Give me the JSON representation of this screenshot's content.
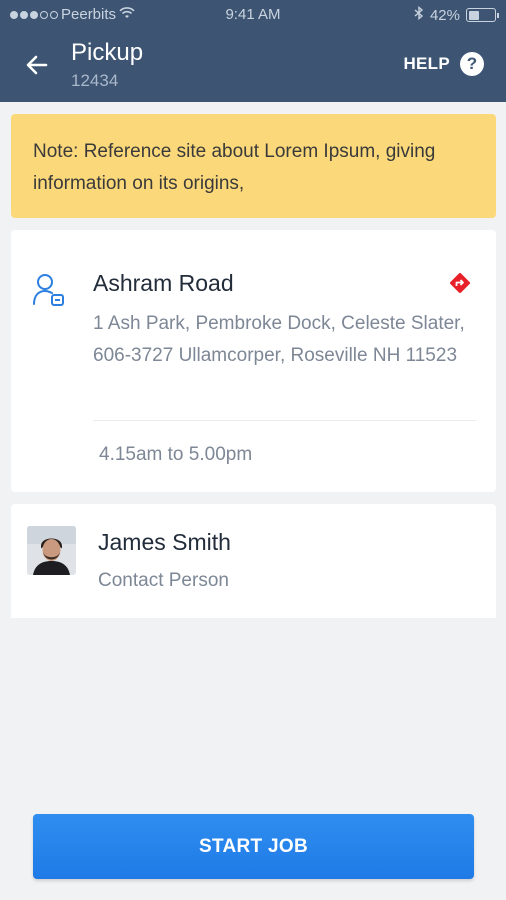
{
  "status_bar": {
    "carrier": "Peerbits",
    "time": "9:41 AM",
    "battery": "42%",
    "battery_level": 0.42,
    "signal_bars_filled": 3,
    "signal_bars_total": 5
  },
  "header": {
    "title": "Pickup",
    "subtitle": "12434",
    "help_label": "HELP",
    "help_icon_glyph": "?",
    "background_color": "#3d5573"
  },
  "note": {
    "text": "Note: Reference site about Lorem Ipsum, giving information on its origins,",
    "background_color": "#fbd97a"
  },
  "address_card": {
    "title": "Ashram Road",
    "address": "1 Ash Park, Pembroke Dock,  Celeste Slater, 606-3727 Ullamcorper, Roseville NH 11523",
    "time_window": "4.15am to 5.00pm",
    "icon": "person-location-icon",
    "nav_icon": "directions-icon",
    "nav_icon_color": "#e8202a"
  },
  "contact_card": {
    "name": "James Smith",
    "role": "Contact Person",
    "avatar": "avatar-photo"
  },
  "actions": {
    "start_job_label": "START JOB",
    "accent_color": "#2385ec"
  }
}
